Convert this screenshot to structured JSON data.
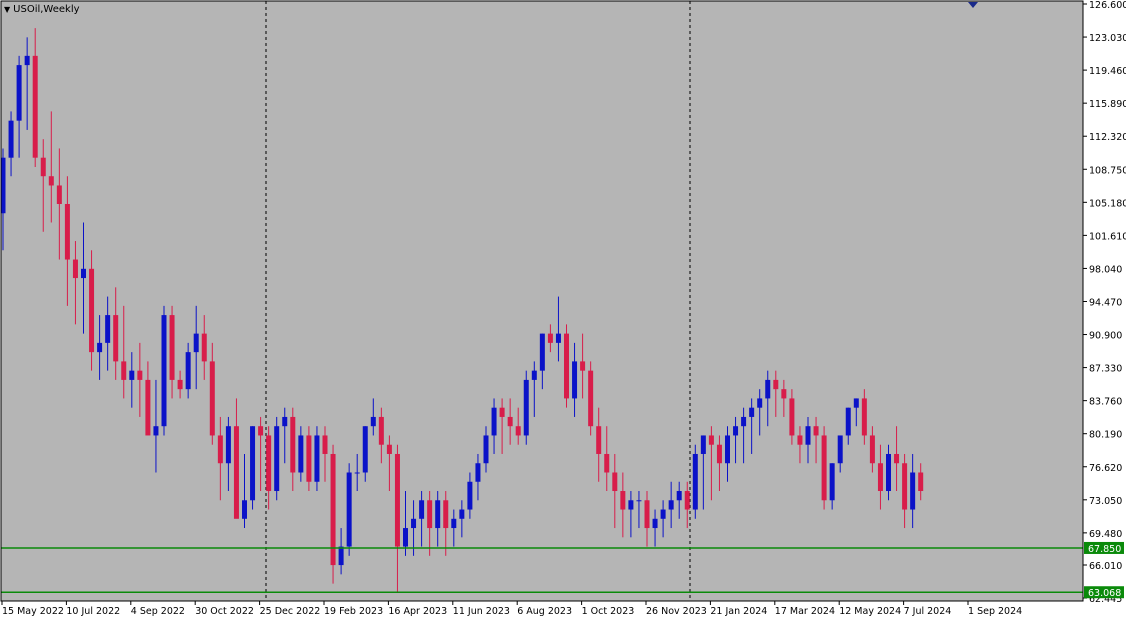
{
  "chart": {
    "symbol": "USOil,Weekly",
    "colors": {
      "background": "#b5b5b5",
      "bull": "#0b12c8",
      "bear": "#d81d4a",
      "support": "#0a8a0a",
      "grid": "#000000",
      "axis_text": "#000000"
    },
    "support_labels": [
      "67.850",
      "63.068"
    ],
    "price_ticks": [
      "126.600",
      "123.030",
      "119.460",
      "115.890",
      "112.320",
      "108.750",
      "105.180",
      "101.610",
      "98.040",
      "94.470",
      "90.900",
      "87.330",
      "83.760",
      "80.190",
      "76.620",
      "73.050",
      "69.480",
      "66.010",
      "62.445"
    ],
    "date_ticks": [
      "15 May 2022",
      "10 Jul 2022",
      "4 Sep 2022",
      "30 Oct 2022",
      "25 Dec 2022",
      "19 Feb 2023",
      "16 Apr 2023",
      "11 Jun 2023",
      "6 Aug 2023",
      "1 Oct 2023",
      "26 Nov 2023",
      "21 Jan 2024",
      "17 Mar 2024",
      "12 May 2024",
      "7 Jul 2024",
      "1 Sep 2024"
    ],
    "period_separators": [
      "1 Jan 2023",
      "1 Jan 2024"
    ]
  },
  "chart_data": {
    "type": "candlestick",
    "title": "USOil,Weekly",
    "ylim": [
      62.445,
      126.6
    ],
    "support_levels": [
      67.85,
      63.068
    ],
    "ohlc": [
      [
        104,
        111,
        100,
        110
      ],
      [
        110,
        115,
        108,
        114
      ],
      [
        114,
        121,
        110,
        120
      ],
      [
        120,
        123,
        113,
        121
      ],
      [
        121,
        124,
        109,
        110
      ],
      [
        110,
        112,
        102,
        108
      ],
      [
        108,
        115,
        103,
        107
      ],
      [
        107,
        111,
        99,
        105
      ],
      [
        105,
        108,
        94,
        99
      ],
      [
        99,
        101,
        92,
        97
      ],
      [
        97,
        103,
        91,
        98
      ],
      [
        98,
        100,
        87,
        89
      ],
      [
        89,
        93,
        86,
        90
      ],
      [
        90,
        95,
        87,
        93
      ],
      [
        93,
        96,
        86,
        88
      ],
      [
        88,
        94,
        84,
        86
      ],
      [
        86,
        89,
        83,
        87
      ],
      [
        87,
        90,
        82,
        86
      ],
      [
        86,
        88,
        81,
        80
      ],
      [
        80,
        86,
        76,
        81
      ],
      [
        81,
        94,
        80,
        93
      ],
      [
        93,
        94,
        84,
        86
      ],
      [
        86,
        87,
        84,
        85
      ],
      [
        85,
        90,
        84,
        89
      ],
      [
        89,
        94,
        85,
        91
      ],
      [
        91,
        93,
        86,
        88
      ],
      [
        88,
        90,
        79,
        80
      ],
      [
        80,
        82,
        73,
        77
      ],
      [
        77,
        82,
        74,
        81
      ],
      [
        81,
        84,
        72,
        71
      ],
      [
        71,
        78,
        70,
        73
      ],
      [
        73,
        81,
        72,
        81
      ],
      [
        81,
        82,
        74,
        80
      ],
      [
        80,
        81,
        72,
        74
      ],
      [
        74,
        82,
        73,
        81
      ],
      [
        81,
        83,
        77,
        82
      ],
      [
        82,
        83,
        74,
        76
      ],
      [
        76,
        81,
        75,
        80
      ],
      [
        80,
        81,
        74,
        75
      ],
      [
        75,
        81,
        74,
        80
      ],
      [
        80,
        81,
        75,
        78
      ],
      [
        78,
        79,
        64,
        66
      ],
      [
        66,
        70,
        65,
        68
      ],
      [
        68,
        77,
        67,
        76
      ],
      [
        76,
        78,
        74,
        76
      ],
      [
        76,
        81,
        75,
        81
      ],
      [
        81,
        84,
        80,
        82
      ],
      [
        82,
        83,
        77,
        79
      ],
      [
        79,
        80,
        74,
        78
      ],
      [
        78,
        79,
        63,
        68
      ],
      [
        68,
        74,
        67,
        70
      ],
      [
        70,
        73,
        67,
        71
      ],
      [
        71,
        74,
        68,
        73
      ],
      [
        73,
        74,
        67,
        70
      ],
      [
        70,
        74,
        68,
        73
      ],
      [
        73,
        74,
        67,
        70
      ],
      [
        70,
        72,
        68,
        71
      ],
      [
        71,
        73,
        69,
        72
      ],
      [
        72,
        76,
        71,
        75
      ],
      [
        75,
        78,
        73,
        77
      ],
      [
        77,
        81,
        76,
        80
      ],
      [
        80,
        84,
        78,
        83
      ],
      [
        83,
        84,
        78,
        82
      ],
      [
        82,
        84,
        79,
        81
      ],
      [
        81,
        83,
        79,
        80
      ],
      [
        80,
        87,
        79,
        86
      ],
      [
        86,
        88,
        82,
        87
      ],
      [
        87,
        91,
        85,
        91
      ],
      [
        91,
        92,
        89,
        90
      ],
      [
        90,
        95,
        88,
        91
      ],
      [
        91,
        92,
        83,
        84
      ],
      [
        84,
        90,
        82,
        88
      ],
      [
        88,
        91,
        84,
        87
      ],
      [
        87,
        88,
        80,
        81
      ],
      [
        81,
        83,
        75,
        78
      ],
      [
        78,
        81,
        74,
        76
      ],
      [
        76,
        78,
        70,
        74
      ],
      [
        74,
        76,
        69,
        72
      ],
      [
        72,
        74,
        69,
        73
      ],
      [
        73,
        74,
        70,
        73
      ],
      [
        73,
        74,
        68,
        70
      ],
      [
        70,
        72,
        68,
        71
      ],
      [
        71,
        73,
        69,
        72
      ],
      [
        72,
        75,
        70,
        73
      ],
      [
        73,
        75,
        71,
        74
      ],
      [
        74,
        75,
        70,
        72
      ],
      [
        72,
        79,
        71,
        78
      ],
      [
        78,
        80,
        72,
        80
      ],
      [
        80,
        81,
        73,
        79
      ],
      [
        79,
        80,
        74,
        77
      ],
      [
        77,
        81,
        75,
        80
      ],
      [
        80,
        82,
        77,
        81
      ],
      [
        81,
        83,
        77,
        82
      ],
      [
        82,
        84,
        78,
        83
      ],
      [
        83,
        85,
        80,
        84
      ],
      [
        84,
        87,
        81,
        86
      ],
      [
        86,
        87,
        82,
        85
      ],
      [
        85,
        86,
        82,
        84
      ],
      [
        84,
        85,
        79,
        80
      ],
      [
        80,
        81,
        77,
        79
      ],
      [
        79,
        82,
        77,
        81
      ],
      [
        81,
        82,
        77,
        80
      ],
      [
        80,
        81,
        72,
        73
      ],
      [
        73,
        77,
        72,
        77
      ],
      [
        77,
        80,
        76,
        80
      ],
      [
        80,
        83,
        79,
        83
      ],
      [
        83,
        84,
        81,
        84
      ],
      [
        84,
        85,
        79,
        80
      ],
      [
        80,
        81,
        76,
        77
      ],
      [
        77,
        79,
        72,
        74
      ],
      [
        74,
        79,
        73,
        78
      ],
      [
        78,
        81,
        74,
        77
      ],
      [
        77,
        78,
        70,
        72
      ],
      [
        72,
        78,
        70,
        76
      ],
      [
        76,
        77,
        73,
        74
      ]
    ]
  }
}
